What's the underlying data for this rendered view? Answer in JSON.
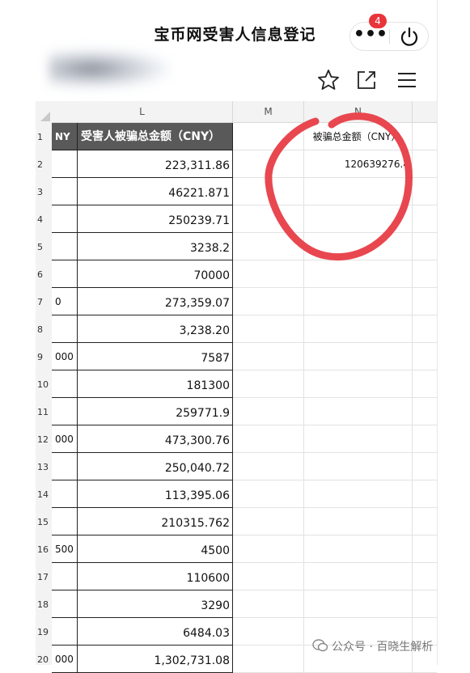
{
  "header": {
    "title": "宝币网受害人信息登记",
    "notification_count": "4",
    "more_icon": "more-dots-icon",
    "power_icon": "power-icon",
    "star_icon": "star-icon",
    "share_icon": "open-external-icon",
    "menu_icon": "hamburger-menu-icon"
  },
  "sheet": {
    "columns": [
      "L",
      "M",
      "N"
    ],
    "header_row": {
      "k": "NY",
      "l": "受害人被骗总金额（CNY）",
      "n": "被骗总金额（CNY）"
    },
    "n2_value": "120639276.4",
    "rows": [
      {
        "num": "1"
      },
      {
        "num": "2",
        "k": "",
        "l": "223,311.86"
      },
      {
        "num": "3",
        "k": "",
        "l": "46221.871"
      },
      {
        "num": "4",
        "k": "",
        "l": "250239.71"
      },
      {
        "num": "5",
        "k": "",
        "l": "3238.2"
      },
      {
        "num": "6",
        "k": "",
        "l": "70000"
      },
      {
        "num": "7",
        "k": "0",
        "l": "273,359.07"
      },
      {
        "num": "8",
        "k": "",
        "l": "3,238.20"
      },
      {
        "num": "9",
        "k": "000",
        "l": "7587"
      },
      {
        "num": "10",
        "k": "",
        "l": "181300"
      },
      {
        "num": "11",
        "k": "",
        "l": "259771.9"
      },
      {
        "num": "12",
        "k": "000",
        "l": "473,300.76"
      },
      {
        "num": "13",
        "k": "",
        "l": "250,040.72"
      },
      {
        "num": "14",
        "k": "",
        "l": "113,395.06"
      },
      {
        "num": "15",
        "k": "",
        "l": "210315.762"
      },
      {
        "num": "16",
        "k": "500",
        "l": "4500"
      },
      {
        "num": "17",
        "k": "",
        "l": "110600"
      },
      {
        "num": "18",
        "k": "",
        "l": "3290"
      },
      {
        "num": "19",
        "k": "",
        "l": "6484.03"
      },
      {
        "num": "20",
        "k": "000",
        "l": "1,302,731.08"
      }
    ]
  },
  "annotation": {
    "circle_color": "#e8474f"
  },
  "watermark": {
    "text": "公众号 · 百晓生解析"
  }
}
